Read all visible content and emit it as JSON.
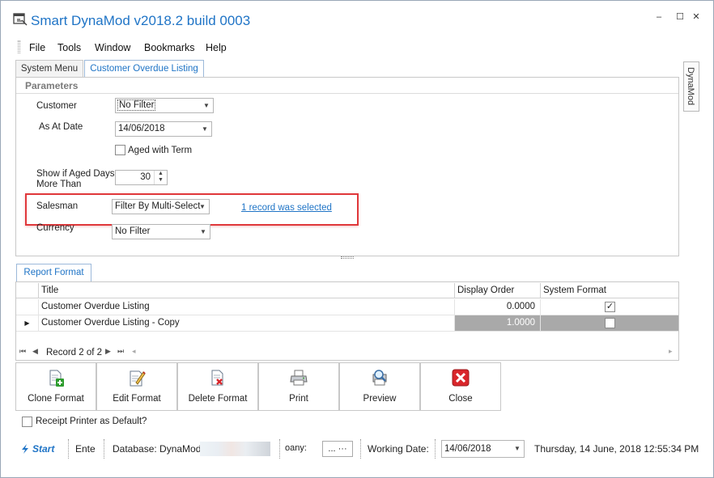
{
  "window": {
    "title": "Smart DynaMod v2018.2 build 0003",
    "controls": {
      "minimize": "–",
      "maximize": "☐",
      "close": "✕"
    }
  },
  "menu": {
    "items": [
      "File",
      "Tools",
      "Window",
      "Bookmarks",
      "Help"
    ]
  },
  "tabs": [
    {
      "label": "System Menu",
      "active": false
    },
    {
      "label": "Customer Overdue Listing",
      "active": true
    }
  ],
  "side_tab": {
    "label": "DynaMod"
  },
  "parameters": {
    "header": "Parameters",
    "customer": {
      "label": "Customer",
      "value": "No Filter"
    },
    "as_at_date": {
      "label": "As At Date",
      "value": "14/06/2018"
    },
    "aged_with_term": {
      "label": "Aged with Term",
      "checked": false
    },
    "show_if_aged": {
      "label_line1": "Show if Aged Days",
      "label_line2": "More Than",
      "value": "30"
    },
    "salesman": {
      "label": "Salesman",
      "value": "Filter By Multi-Select",
      "link": "1 record was selected"
    },
    "currency": {
      "label": "Currency",
      "value": "No Filter"
    }
  },
  "report_format": {
    "tab_label": "Report Format",
    "columns": [
      "Title",
      "Display Order",
      "System Format"
    ],
    "rows": [
      {
        "title": "Customer Overdue Listing",
        "display_order": "0.0000",
        "system_format": true,
        "selected": false
      },
      {
        "title": "Customer Overdue Listing - Copy",
        "display_order": "1.0000",
        "system_format": false,
        "selected": true
      }
    ],
    "navigator": {
      "record_text": "Record 2 of 2"
    }
  },
  "toolbar": {
    "buttons": [
      {
        "label": "Clone Format",
        "icon": "clone-format-icon"
      },
      {
        "label": "Edit Format",
        "icon": "edit-format-icon"
      },
      {
        "label": "Delete Format",
        "icon": "delete-format-icon"
      },
      {
        "label": "Print",
        "icon": "printer-icon"
      },
      {
        "label": "Preview",
        "icon": "preview-icon"
      },
      {
        "label": "Close",
        "icon": "close-red-icon"
      }
    ]
  },
  "receipt_printer": {
    "label": "Receipt Printer as Default?",
    "checked": false
  },
  "status": {
    "start_label": "Start",
    "enter_text": "Ente",
    "database_label": "Database: DynaMod",
    "company_label": "oany:",
    "company_button": "... ···",
    "working_date_label": "Working Date:",
    "working_date_value": "14/06/2018",
    "datetime": "Thursday, 14 June, 2018 12:55:34 PM"
  },
  "colors": {
    "accent": "#1f74c6",
    "highlight_border": "#e0383b",
    "selected_row": "#a9a9a9"
  }
}
